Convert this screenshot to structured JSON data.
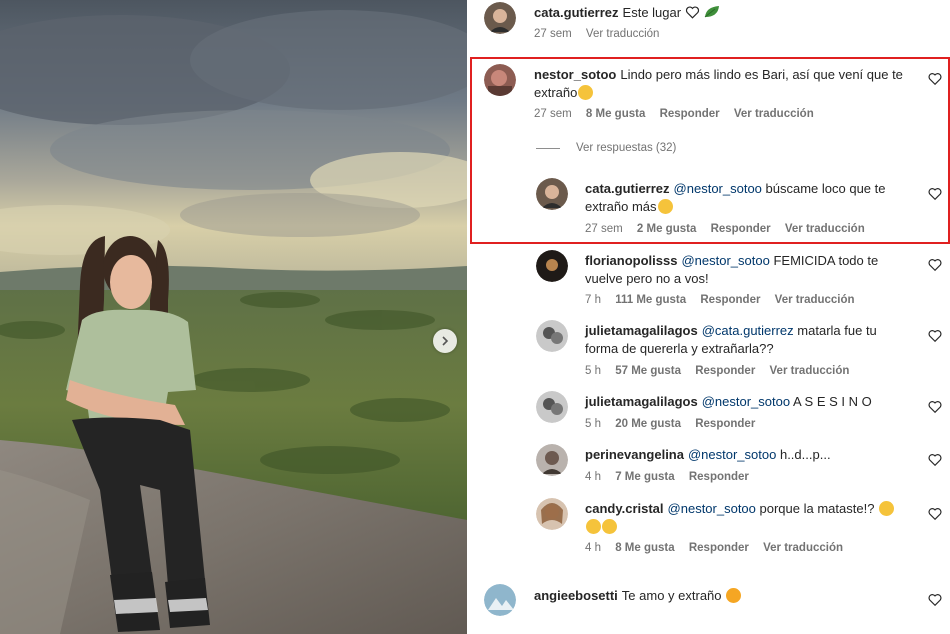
{
  "comments": [
    {
      "user": "cata.gutierrez",
      "text": "Este lugar",
      "time": "27 sem",
      "translate": "Ver traducción"
    },
    {
      "user": "nestor_sotoo",
      "text_line1": "Lindo pero más lindo es Bari, así que vení que te",
      "text_line2": "extraño",
      "time": "27 sem",
      "likes": "8 Me gusta",
      "reply": "Responder",
      "translate": "Ver traducción"
    },
    {
      "user": "cata.gutierrez",
      "mention": "@nestor_sotoo",
      "text_line1": "búscame loco que te",
      "text_line2": "extraño más",
      "time": "27 sem",
      "likes": "2 Me gusta",
      "reply": "Responder",
      "translate": "Ver traducción"
    },
    {
      "user": "florianopolisss",
      "mention": "@nestor_sotoo",
      "text_line1": "FEMICIDA todo te",
      "text_line2": "vuelve pero no a vos!",
      "time": "7 h",
      "likes": "111 Me gusta",
      "reply": "Responder",
      "translate": "Ver traducción"
    },
    {
      "user": "julietamagalilagos",
      "mention": "@cata.gutierrez",
      "text_line1": "matarla fue tu",
      "text_line2": "forma de quererla y extrañarla??",
      "time": "5 h",
      "likes": "57 Me gusta",
      "reply": "Responder",
      "translate": "Ver traducción"
    },
    {
      "user": "julietamagalilagos",
      "mention": "@nestor_sotoo",
      "text_line1": "A S E S I N O",
      "time": "5 h",
      "likes": "20 Me gusta",
      "reply": "Responder"
    },
    {
      "user": "perinevangelina",
      "mention": "@nestor_sotoo",
      "text_line1": "h..d...p...",
      "time": "4 h",
      "likes": "7 Me gusta",
      "reply": "Responder"
    },
    {
      "user": "candy.cristal",
      "mention": "@nestor_sotoo",
      "text_line1": "porque la mataste!?",
      "time": "4 h",
      "likes": "8 Me gusta",
      "reply": "Responder",
      "translate": "Ver traducción"
    },
    {
      "user": "angieebosetti",
      "text": "Te amo y extraño"
    }
  ],
  "replies_toggle": "Ver respuestas (32)",
  "colors": {
    "highlight": "#e02020",
    "mention": "#00376b",
    "meta": "#737373"
  }
}
